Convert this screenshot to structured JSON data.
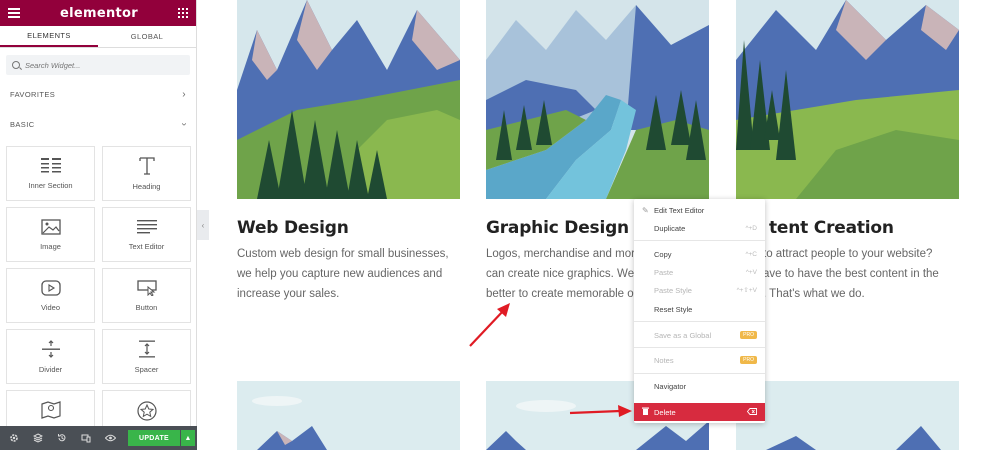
{
  "sidebar": {
    "brand": "elementor",
    "tabs": [
      "ELEMENTS",
      "GLOBAL"
    ],
    "search_placeholder": "Search Widget...",
    "sections": {
      "favorites": "FAVORITES",
      "basic": "BASIC"
    },
    "widgets": [
      "Inner Section",
      "Heading",
      "Image",
      "Text Editor",
      "Video",
      "Button",
      "Divider",
      "Spacer"
    ],
    "update_label": "UPDATE"
  },
  "cards": [
    {
      "title": "Web Design",
      "lines": [
        "Custom web design for small businesses,",
        "we help you capture new audiences and",
        "increase your sales."
      ]
    },
    {
      "title": "Graphic Design",
      "lines": [
        "Logos, merchandise and more",
        "can create nice graphics. We t",
        "better to create memorable or"
      ]
    },
    {
      "title": "tent Creation",
      "lines": [
        "to attract people to your website?",
        "ave to have the best content in the",
        ". That's what we do."
      ]
    }
  ],
  "context_menu": {
    "items": [
      {
        "label": "Edit Text Editor",
        "shortcut": "",
        "icon": "pencil-icon"
      },
      {
        "label": "Duplicate",
        "shortcut": "^+D",
        "icon": ""
      },
      {
        "label": "Copy",
        "shortcut": "^+C",
        "icon": ""
      },
      {
        "label": "Paste",
        "shortcut": "^+V",
        "icon": ""
      },
      {
        "label": "Paste Style",
        "shortcut": "^+⇧+V",
        "icon": ""
      },
      {
        "label": "Reset Style",
        "shortcut": "",
        "icon": ""
      },
      {
        "label": "Save as a Global",
        "shortcut": "",
        "badge": "PRO"
      },
      {
        "label": "Notes",
        "shortcut": "",
        "badge": "PRO"
      },
      {
        "label": "Navigator",
        "shortcut": ""
      },
      {
        "label": "Delete",
        "shortcut": "⌦",
        "icon": "trash-icon"
      }
    ]
  },
  "colors": {
    "brand": "#92003b",
    "update_green": "#39b54a",
    "delete_red": "#d72b3f",
    "arrow_red": "#e01b24"
  }
}
